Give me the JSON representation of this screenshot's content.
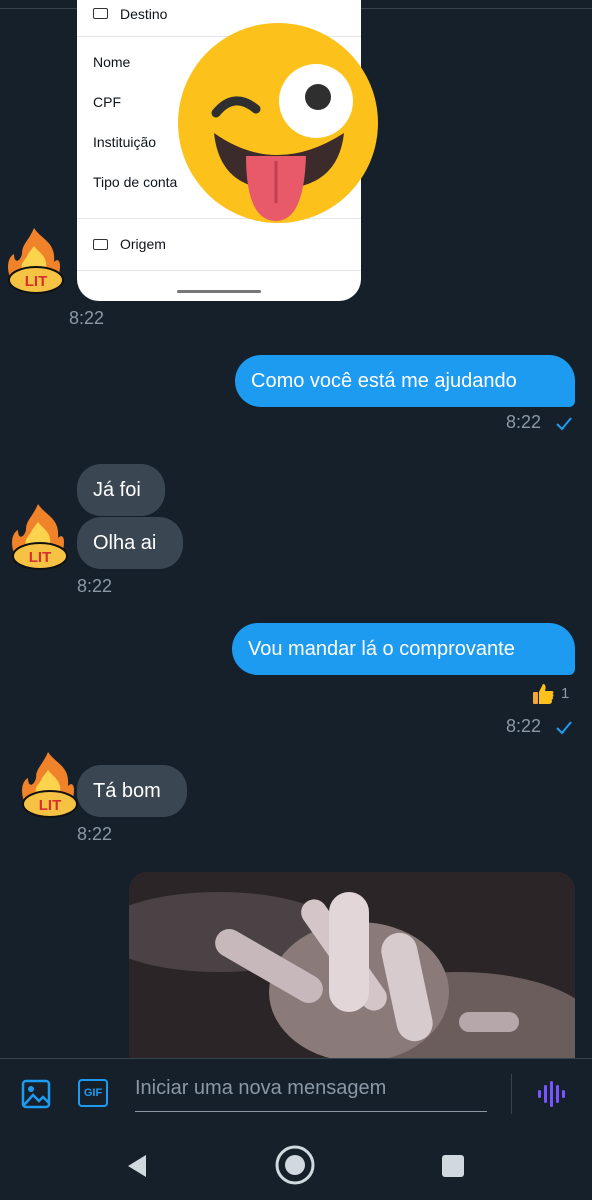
{
  "shared_screenshot": {
    "rows": [
      "Destino",
      "Nome",
      "CPF",
      "Instituição",
      "Tipo de conta",
      "Origem"
    ]
  },
  "messages": {
    "m1_time": "8:22",
    "m2_text": "Como você está me ajudando",
    "m2_time": "8:22",
    "m3_text": "Já foi",
    "m4_text": "Olha ai",
    "m4_time": "8:22",
    "m5_text": "Vou mandar lá o comprovante",
    "m5_reaction_count": "1",
    "m5_time": "8:22",
    "m6_text": "Tá bom",
    "m6_time": "8:22"
  },
  "avatar_text": "LIT",
  "composer": {
    "placeholder": "Iniciar uma nova mensagem",
    "gif_label": "GIF"
  },
  "colors": {
    "background": "#15202b",
    "outgoing": "#1d9bf0",
    "incoming": "#3a4753",
    "accent_voice": "#7856ff"
  },
  "icons": [
    "image-icon",
    "gif-icon",
    "voice-icon",
    "check-icon",
    "thumbs-up-icon",
    "back-icon",
    "home-icon",
    "recents-icon"
  ]
}
